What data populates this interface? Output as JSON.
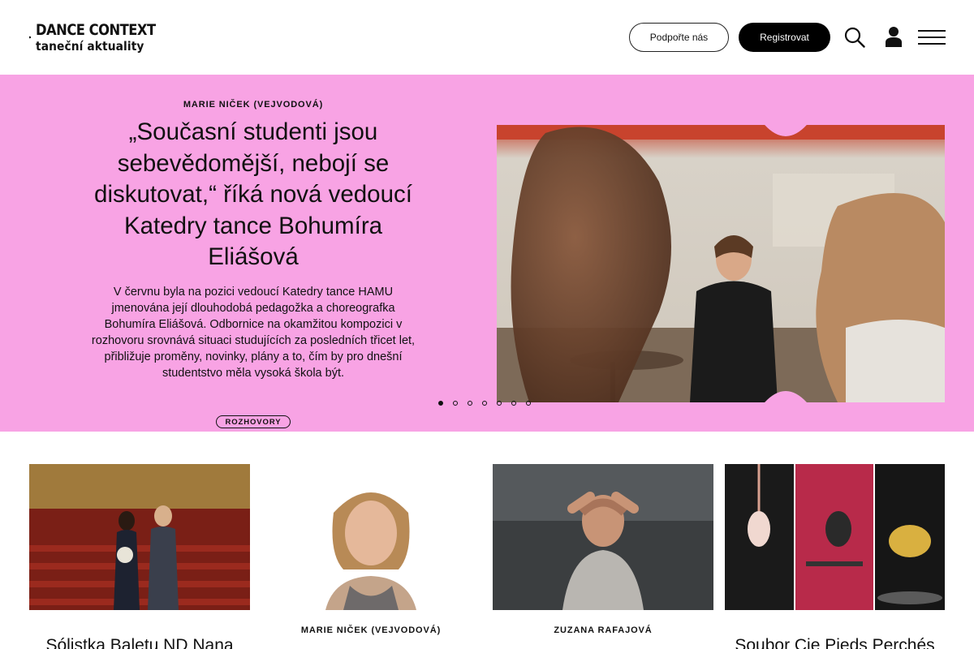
{
  "header": {
    "logo_line1": "DANCE CONTEXT",
    "logo_line2": "taneční aktuality",
    "support_label": "Podpořte nás",
    "register_label": "Registrovat",
    "icons": [
      "search-icon",
      "user-icon",
      "menu-icon"
    ]
  },
  "hero": {
    "author": "MARIE NIČEK (VEJVODOVÁ)",
    "title": "„Současní studenti jsou sebevědomější, nebojí se diskutovat,“ říká nová vedoucí Katedry tance Bohumíra Eliášová",
    "lead": "V červnu byla na pozici vedoucí Katedry tance HAMU jmenována její dlouhodobá pedagožka a choreografka Bohumíra Eliášová. Odbornice na okamžitou kompozici v rozhovoru srovnává situaci studujících za posledních třicet let, přibližuje proměny, novinky, plány a to, čím by pro dnešní studentstvo měla vysoká škola být.",
    "tag": "ROZHOVORY",
    "slides_total": 7,
    "active_slide": 1,
    "background": "#f8a3e4"
  },
  "cards": [
    {
      "author": "",
      "title": "Sólistka Baletu ND Nana"
    },
    {
      "author": "MARIE NIČEK (VEJVODOVÁ)",
      "title": ""
    },
    {
      "author": "ZUZANA RAFAJOVÁ",
      "title": ""
    },
    {
      "author": "",
      "title": "Soubor Cie Pieds Perchés"
    }
  ]
}
